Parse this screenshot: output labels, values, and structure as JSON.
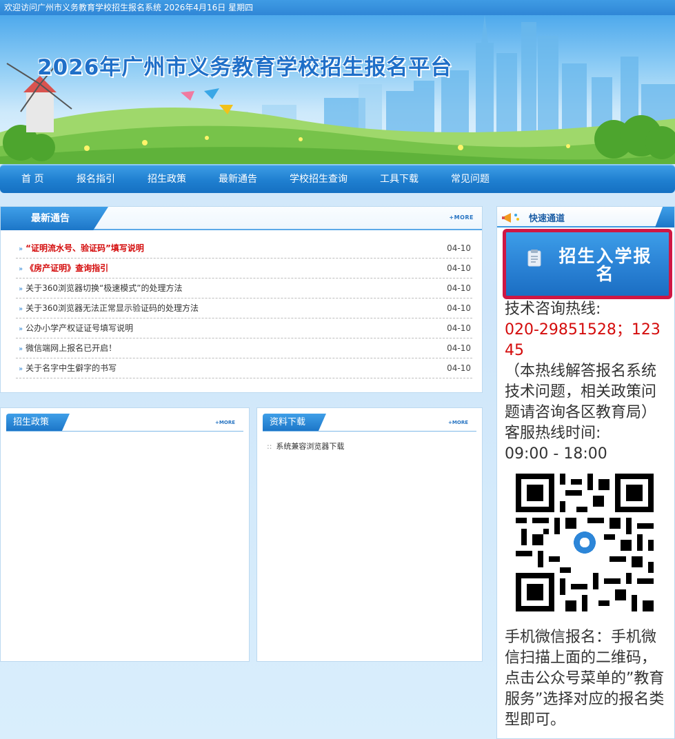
{
  "top_bar": {
    "text": "欢迎访问广州市义务教育学校招生报名系统 2026年4月16日 星期四"
  },
  "banner": {
    "title": "2026年广州市义务教育学校招生报名平台"
  },
  "nav": {
    "items": [
      {
        "label": "首  页"
      },
      {
        "label": "报名指引"
      },
      {
        "label": "招生政策"
      },
      {
        "label": "最新通告"
      },
      {
        "label": "学校招生查询"
      },
      {
        "label": "工具下载"
      },
      {
        "label": "常见问题"
      }
    ]
  },
  "notices": {
    "title": "最新通告",
    "more": "+MORE",
    "items": [
      {
        "title": "“证明流水号、验证码”填写说明",
        "date": "04-10",
        "highlight": true
      },
      {
        "title": "《房产证明》查询指引",
        "date": "04-10",
        "highlight": true
      },
      {
        "title": "关于360浏览器切换“极速模式”的处理方法",
        "date": "04-10",
        "highlight": false
      },
      {
        "title": "关于360浏览器无法正常显示验证码的处理方法",
        "date": "04-10",
        "highlight": false
      },
      {
        "title": "公办小学产权证证号填写说明",
        "date": "04-10",
        "highlight": false
      },
      {
        "title": "微信端网上报名已开启！",
        "date": "04-10",
        "highlight": false
      },
      {
        "title": "关于名字中生僻字的书写",
        "date": "04-10",
        "highlight": false
      }
    ]
  },
  "policy": {
    "title": "招生政策",
    "more": "+MORE"
  },
  "downloads": {
    "title": "资料下载",
    "more": "+MORE",
    "items": [
      {
        "title": "系统兼容浏览器下载"
      }
    ]
  },
  "sidebar": {
    "title": "快速通道",
    "enroll_button": "招生入学报名",
    "hotline_label": "技术咨询热线:",
    "hotline_numbers": "020-29851528；12345",
    "hotline_note": "（本热线解答报名系统技术问题，相关政策问题请咨询各区教育局）",
    "service_hours_label": "客服热线时间:",
    "service_hours": "09:00 - 18:00",
    "wechat_text": "手机微信报名：手机微信扫描上面的二维码，点击公众号菜单的”教育服务”选择对应的报名类型即可。"
  },
  "colors": {
    "primary": "#1f7fd0",
    "highlight_red": "#d40b0b",
    "enroll_border": "#cf1744"
  }
}
